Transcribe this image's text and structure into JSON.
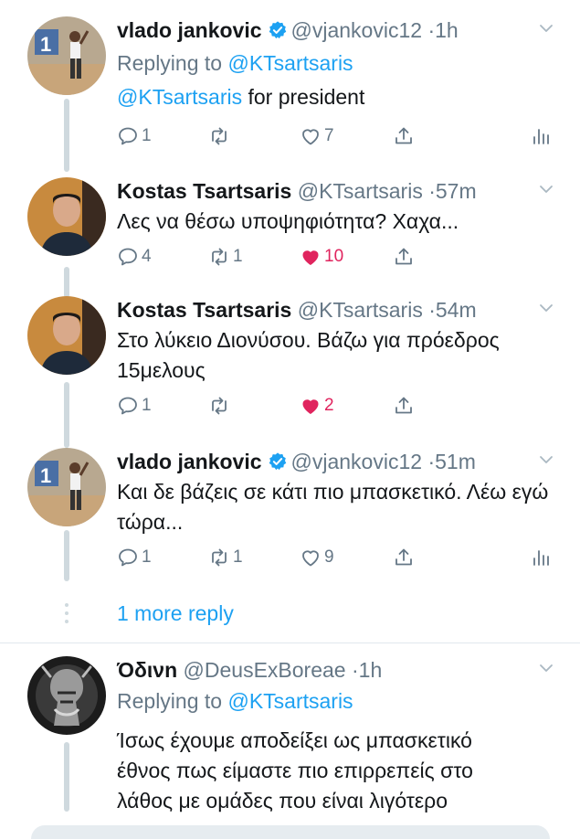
{
  "colors": {
    "accent": "#1da1f2",
    "text": "#14171a",
    "muted": "#657786",
    "like": "#e0245e",
    "line": "#cfd9de"
  },
  "tweets": [
    {
      "name": "vlado jankovic",
      "handle": "@vjankovic12",
      "dot": "·",
      "time": "1h",
      "verified": true,
      "replying_label": "Replying to",
      "replying_to": "@KTsartsaris",
      "mention": "@KTsartsaris",
      "text": " for president",
      "reply_count": "1",
      "retweet_count": "",
      "like_count": "7",
      "liked": false,
      "icons": [
        "reply-icon",
        "retweet-icon",
        "like-icon",
        "share-icon",
        "stats-icon"
      ]
    },
    {
      "name": "Kostas Tsartsaris",
      "handle": "@KTsartsaris",
      "dot": "·",
      "time": "57m",
      "verified": false,
      "text": "Λες να θέσω υποψηφιότητα? Χαχα...",
      "reply_count": "4",
      "retweet_count": "1",
      "like_count": "10",
      "liked": true
    },
    {
      "name": "Kostas Tsartsaris",
      "handle": "@KTsartsaris",
      "dot": "·",
      "time": "54m",
      "verified": false,
      "text": "Στο λύκειο Διονύσου. Βάζω για πρόεδρος 15μελους",
      "reply_count": "1",
      "retweet_count": "",
      "like_count": "2",
      "liked": true
    },
    {
      "name": "vlado jankovic",
      "handle": "@vjankovic12",
      "dot": "·",
      "time": "51m",
      "verified": true,
      "text": "Και δε βάζεις σε κάτι πιο μπασκετικό. Λέω εγώ τώρα...",
      "reply_count": "1",
      "retweet_count": "1",
      "like_count": "9",
      "liked": false
    },
    {
      "name": "Όδινn",
      "handle": "@DeusExBoreae",
      "dot": "·",
      "time": "1h",
      "verified": false,
      "replying_label": "Replying to",
      "replying_to": "@KTsartsaris",
      "text": "Ίσως έχουμε αποδείξει ως μπασκετικό έθνος πως είμαστε πιο επιρρεπείς στο λάθος με ομάδες που είναι λιγότερο"
    }
  ],
  "more_reply": "1 more reply"
}
